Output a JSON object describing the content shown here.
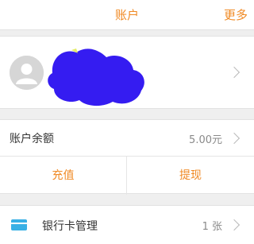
{
  "header": {
    "title": "账户",
    "more_label": "更多"
  },
  "profile": {
    "avatar_icon": "user-avatar-icon",
    "redaction_color": "#2a10f0"
  },
  "balance": {
    "label": "账户余额",
    "value": "5.00元"
  },
  "actions": {
    "recharge_label": "充值",
    "withdraw_label": "提现"
  },
  "bank_card": {
    "label": "银行卡管理",
    "count": "1 张",
    "icon": "bank-card-icon"
  },
  "colors": {
    "accent": "#f08a24",
    "card_icon": "#39b0e5",
    "background": "#efefef"
  }
}
